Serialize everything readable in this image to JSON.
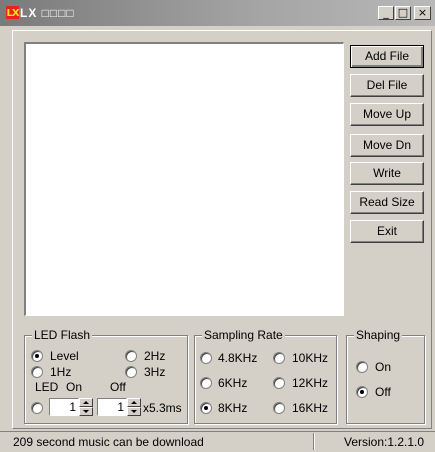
{
  "window": {
    "title": "LX □□□□",
    "icon": "lx-app-icon",
    "icon_text": "LX",
    "controls": {
      "minimize": "_",
      "maximize": "□",
      "close": "×"
    }
  },
  "file_list": {
    "items": []
  },
  "buttons": {
    "add_file": "Add File",
    "del_file": "Del File",
    "move_up": "Move Up",
    "move_dn": "Move Dn",
    "write": "Write",
    "read_size": "Read Size",
    "exit": "Exit"
  },
  "led_flash": {
    "title": "LED Flash",
    "options": {
      "level": "Level",
      "hz1": "1Hz",
      "hz2": "2Hz",
      "hz3": "3Hz"
    },
    "selected": "Level",
    "led_label": "LED",
    "on_label": "On",
    "off_label": "Off",
    "on_value": "1",
    "off_value": "1",
    "unit": "x5.3ms"
  },
  "sampling_rate": {
    "title": "Sampling Rate",
    "options": {
      "k48": "4.8KHz",
      "k10": "10KHz",
      "k6": "6KHz",
      "k12": "12KHz",
      "k8": "8KHz",
      "k16": "16KHz"
    },
    "selected": "8KHz"
  },
  "shaping": {
    "title": "Shaping",
    "options": {
      "on": "On",
      "off": "Off"
    },
    "selected": "Off"
  },
  "status": {
    "message": "209 second music can be download",
    "version": "Version:1.2.1.0"
  }
}
